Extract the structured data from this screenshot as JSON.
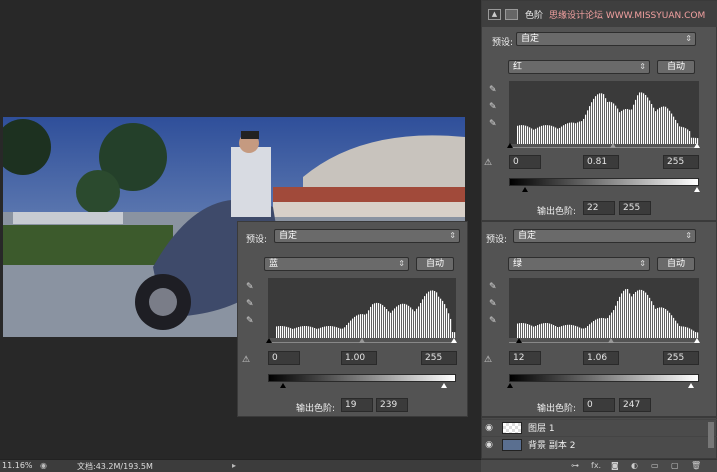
{
  "watermark": "思缘设计论坛 WWW.MISSYUAN.COM",
  "adjust_panel": {
    "title": "色阶"
  },
  "panels": [
    {
      "id": "red",
      "preset_label": "预设:",
      "preset_value": "自定",
      "channel": "红",
      "auto_label": "自动",
      "input_black": "0",
      "input_gamma": "0.81",
      "input_white": "255",
      "output_label": "输出色阶:",
      "output_black": "22",
      "output_white": "255"
    },
    {
      "id": "blue",
      "preset_label": "预设:",
      "preset_value": "自定",
      "channel": "蓝",
      "auto_label": "自动",
      "input_black": "0",
      "input_gamma": "1.00",
      "input_white": "255",
      "output_label": "输出色阶:",
      "output_black": "19",
      "output_white": "239"
    },
    {
      "id": "green",
      "preset_label": "预设:",
      "preset_value": "自定",
      "channel": "绿",
      "auto_label": "自动",
      "input_black": "12",
      "input_gamma": "1.06",
      "input_white": "255",
      "output_label": "输出色阶:",
      "output_black": "0",
      "output_white": "247"
    }
  ],
  "layers": [
    {
      "name": "图层 1"
    },
    {
      "name": "背景 副本 2"
    }
  ],
  "status": {
    "zoom": "11.16%",
    "doc": "文档:43.2M/193.5M"
  },
  "colors": {
    "panel_bg": "#535353",
    "canvas_bg": "#282828",
    "field_bg": "#3b3b3b"
  },
  "icons": [
    "eyedropper-black-icon",
    "eyedropper-gray-icon",
    "eyedropper-white-icon",
    "clip-warning-icon",
    "eye-icon",
    "fx-icon",
    "trash-icon",
    "new-layer-icon",
    "folder-icon",
    "mask-icon",
    "link-icon"
  ]
}
